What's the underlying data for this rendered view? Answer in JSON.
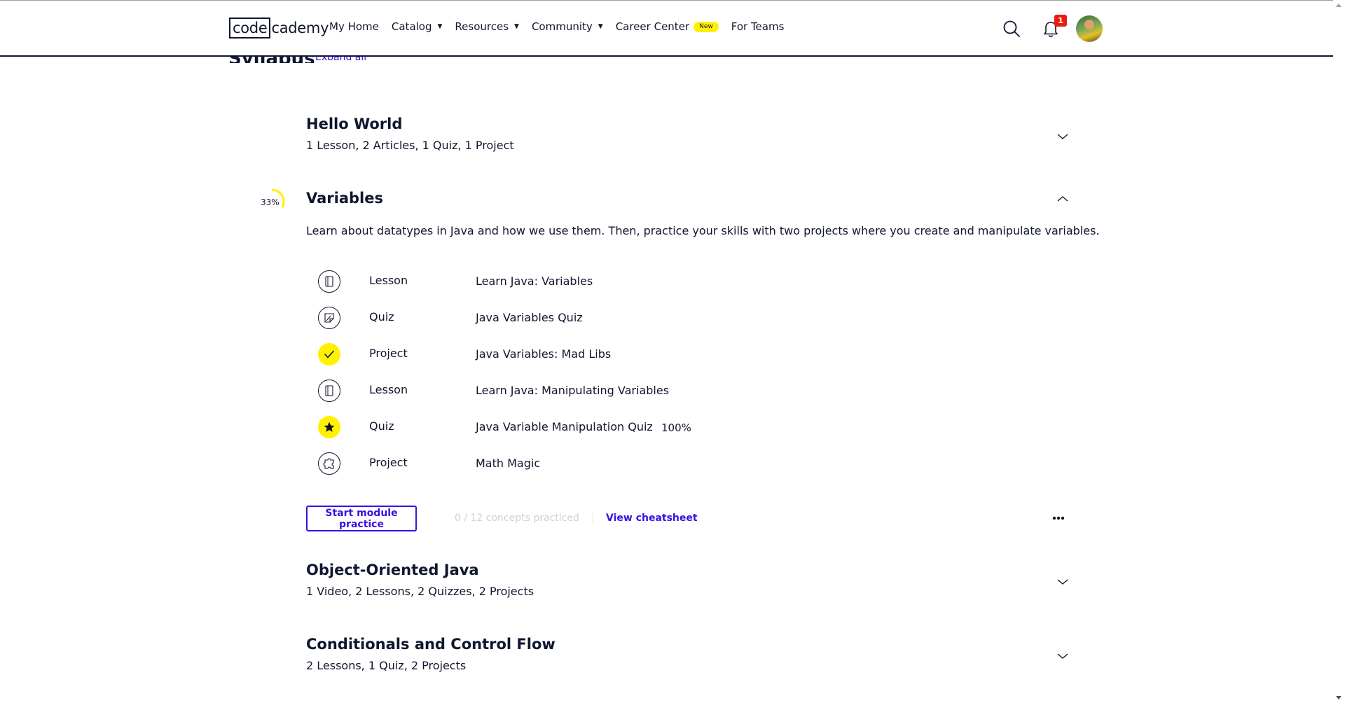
{
  "header": {
    "logo_box": "code",
    "logo_rest": "cademy",
    "nav": [
      {
        "label": "My Home",
        "caret": false
      },
      {
        "label": "Catalog",
        "caret": true
      },
      {
        "label": "Resources",
        "caret": true
      },
      {
        "label": "Community",
        "caret": true
      },
      {
        "label": "Career Center",
        "caret": false,
        "badge": "New"
      },
      {
        "label": "For Teams",
        "caret": false
      }
    ],
    "notification_count": "1",
    "icons": [
      "search-icon",
      "bell-icon",
      "avatar"
    ]
  },
  "page": {
    "section_heading": "Syllabus",
    "expand_all": "Expand all"
  },
  "modules": [
    {
      "title": "Hello World",
      "summary": "1 Lesson, 2 Articles, 1 Quiz, 1 Project",
      "expanded": false
    },
    {
      "title": "Variables",
      "progress_label": "33%",
      "progress_fraction": 0.33,
      "expanded": true,
      "description": "Learn about datatypes in Java and how we use them. Then, practice your skills with two projects where you create and manipulate variables.",
      "items": [
        {
          "type": "Lesson",
          "name": "Learn Java: Variables",
          "icon": "lesson-icon",
          "status": "not-started"
        },
        {
          "type": "Quiz",
          "name": "Java Variables Quiz",
          "icon": "quiz-icon",
          "status": "not-started"
        },
        {
          "type": "Project",
          "name": "Java Variables: Mad Libs",
          "icon": "check-icon",
          "status": "completed"
        },
        {
          "type": "Lesson",
          "name": "Learn Java: Manipulating Variables",
          "icon": "lesson-icon",
          "status": "not-started"
        },
        {
          "type": "Quiz",
          "name": "Java Variable Manipulation Quiz",
          "icon": "star-icon",
          "status": "completed",
          "score": "100%"
        },
        {
          "type": "Project",
          "name": "Math Magic",
          "icon": "puzzle-icon",
          "status": "not-started"
        }
      ],
      "practice_button": "Start module practice",
      "concepts_practiced": "0 / 12 concepts practiced",
      "cheatsheet_link": "View cheatsheet"
    },
    {
      "title": "Object-Oriented Java",
      "summary": "1 Video, 2 Lessons, 2 Quizzes, 2 Projects",
      "expanded": false
    },
    {
      "title": "Conditionals and Control Flow",
      "summary": "2 Lessons, 1 Quiz, 2 Projects",
      "expanded": false
    }
  ],
  "colors": {
    "navy": "#10162f",
    "accent_purple": "#3a10e5",
    "complete_yellow": "#fff100",
    "notification_red": "#e91c11"
  }
}
